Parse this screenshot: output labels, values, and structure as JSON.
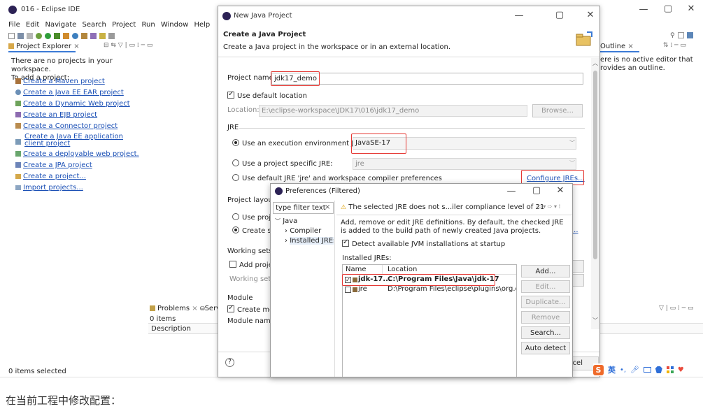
{
  "eclipse": {
    "title": "016 - Eclipse IDE",
    "menu": [
      "File",
      "Edit",
      "Navigate",
      "Search",
      "Project",
      "Run",
      "Window",
      "Help"
    ],
    "project_explorer": {
      "tab": "Project Explorer",
      "intro": [
        "There are no projects in your workspace.",
        "To add a project:"
      ],
      "links": [
        "Create a Maven project",
        "Create a Java EE EAR project",
        "Create a Dynamic Web project",
        "Create an EJB project",
        "Create a Connector project",
        "Create a Java EE application client project",
        "Create a deployable web project.",
        "Create a JPA project",
        "Create a project...",
        "Import projects..."
      ]
    },
    "outline": {
      "tab": "Outline",
      "text": [
        "ere is no active editor that",
        "rovides an outline."
      ]
    },
    "problems": {
      "tab": "Problems",
      "tab2": "Serv",
      "count": "0 items",
      "col": "Description"
    },
    "status": "0 items selected"
  },
  "wizard": {
    "title": "New Java Project",
    "heading": "Create a Java Project",
    "subheading": "Create a Java project in the workspace or in an external location.",
    "project_name_label": "Project name:",
    "project_name_value": "jdk17_demo",
    "use_default_location": "Use default location",
    "location_label": "Location:",
    "location_value": "E:\\eclipse-workspace\\JDK17\\016\\jdk17_demo",
    "browse": "Browse...",
    "jre_group": "JRE",
    "jre_env_label": "Use an execution environment JRE:",
    "jre_env_value": "JavaSE-17",
    "jre_specific_label": "Use a project specific JRE:",
    "jre_specific_value": "jre",
    "jre_default_label": "Use default JRE 'jre' and workspace compiler preferences",
    "configure_jres": "Configure JREs...",
    "project_layout": "Project layou",
    "layout_opt1": "Use proje",
    "layout_opt2": "Create se",
    "working_sets": "Working sets",
    "add_project": "Add proje",
    "working_sets_field": "Working sets",
    "module": "Module",
    "create_module": "Create mo",
    "module_name": "Module name",
    "cancel_fragment": "cel",
    "help": "?"
  },
  "prefs": {
    "title": "Preferences (Filtered)",
    "filter_placeholder": "type filter text",
    "tree": {
      "root": "Java",
      "compiler": "Compiler",
      "installed_jres": "Installed JREs"
    },
    "warning": "The selected JRE does not s...iler compliance level of 21",
    "description": "Add, remove or edit JRE definitions. By default, the checked JRE is added to the build path of newly created Java projects.",
    "detect_label": "Detect available JVM installations at startup",
    "installed_label": "Installed JREs:",
    "columns": [
      "Name",
      "Location"
    ],
    "rows": [
      {
        "name": "jdk-17...",
        "location": "C:\\Program Files\\Java\\jdk-17",
        "checked": true
      },
      {
        "name": "jre",
        "location": "D:\\Program Files\\eclipse\\plugins\\org.eclip",
        "checked": false
      }
    ],
    "buttons": {
      "add": "Add...",
      "edit": "Edit...",
      "duplicate": "Duplicate...",
      "remove": "Remove",
      "search": "Search...",
      "auto_detect": "Auto detect"
    }
  },
  "ime": {
    "label": "英"
  },
  "caption": "在当前工程中修改配置："
}
